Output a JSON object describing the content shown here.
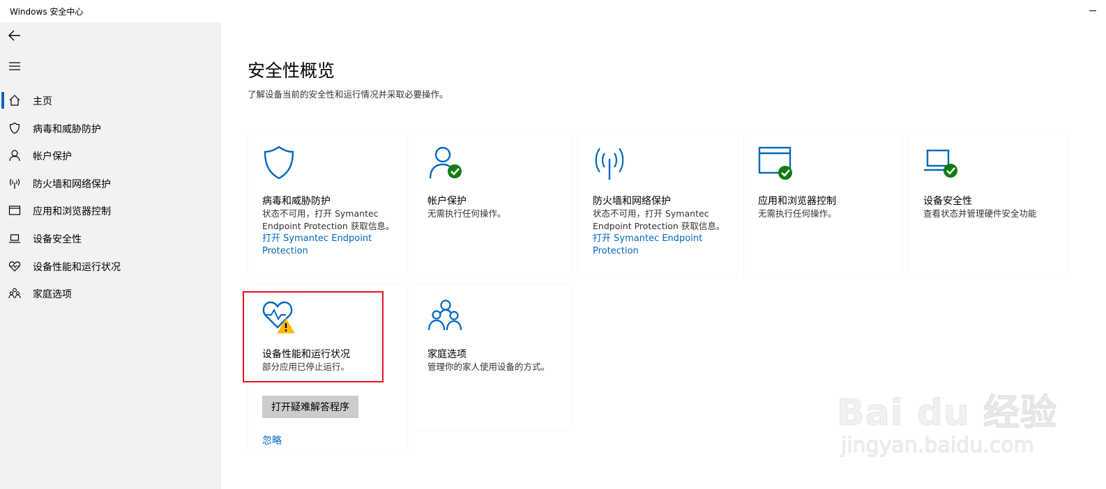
{
  "window": {
    "title": "Windows 安全中心"
  },
  "sidebar": {
    "items": [
      {
        "label": "主页",
        "icon": "home-icon",
        "active": true
      },
      {
        "label": "病毒和威胁防护",
        "icon": "shield-icon"
      },
      {
        "label": "帐户保护",
        "icon": "person-icon"
      },
      {
        "label": "防火墙和网络保护",
        "icon": "antenna-icon"
      },
      {
        "label": "应用和浏览器控制",
        "icon": "browser-window-icon"
      },
      {
        "label": "设备安全性",
        "icon": "laptop-icon"
      },
      {
        "label": "设备性能和运行状况",
        "icon": "heart-icon"
      },
      {
        "label": "家庭选项",
        "icon": "family-icon"
      }
    ]
  },
  "main": {
    "title": "安全性概览",
    "subtitle": "了解设备当前的安全性和运行情况并采取必要操作。",
    "cards": [
      {
        "title": "病毒和威胁防护",
        "desc": "状态不可用，打开 Symantec Endpoint Protection 获取信息。",
        "link": "打开 Symantec Endpoint Protection",
        "icon": "shield-icon"
      },
      {
        "title": "帐户保护",
        "desc": "无需执行任何操作。",
        "icon": "person-check-icon"
      },
      {
        "title": "防火墙和网络保护",
        "desc": "状态不可用，打开 Symantec Endpoint Protection 获取信息。",
        "link": "打开 Symantec Endpoint Protection",
        "icon": "antenna-icon"
      },
      {
        "title": "应用和浏览器控制",
        "desc": "无需执行任何操作。",
        "icon": "browser-check-icon"
      },
      {
        "title": "设备安全性",
        "desc": "查看状态并管理硬件安全功能",
        "icon": "laptop-check-icon"
      },
      {
        "title": "设备性能和运行状况",
        "desc": "部分应用已停止运行。",
        "action": "打开疑难解答程序",
        "dismiss": "忽略",
        "icon": "heart-warning-icon"
      },
      {
        "title": "家庭选项",
        "desc": "管理你的家人使用设备的方式。",
        "icon": "family-icon"
      }
    ]
  },
  "watermark": {
    "main": "Bai du 经验",
    "sub": "jingyan.baidu.com"
  },
  "colors": {
    "accent": "#0067c0",
    "success": "#107c10",
    "warning": "#ffb900",
    "highlight": "#e81123",
    "sidebar_bg": "#f2f2f2"
  }
}
